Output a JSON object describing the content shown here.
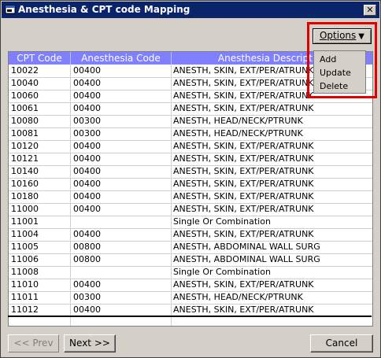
{
  "window": {
    "title": "Anesthesia & CPT code Mapping",
    "close_label": "✕"
  },
  "options_button": {
    "label": "Options",
    "arrow": "▼"
  },
  "options_menu": [
    "Add",
    "Update",
    "Delete"
  ],
  "grid": {
    "columns": [
      "CPT Code",
      "Anesthesia Code",
      "Anesthesia Description"
    ],
    "rows": [
      [
        "10022",
        "00400",
        "ANESTH, SKIN, EXT/PER/ATRUNK"
      ],
      [
        "10040",
        "00400",
        "ANESTH, SKIN, EXT/PER/ATRUNK"
      ],
      [
        "10060",
        "00400",
        "ANESTH, SKIN, EXT/PER/ATRUNK"
      ],
      [
        "10061",
        "00400",
        "ANESTH, SKIN, EXT/PER/ATRUNK"
      ],
      [
        "10080",
        "00300",
        "ANESTH, HEAD/NECK/PTRUNK"
      ],
      [
        "10081",
        "00300",
        "ANESTH, HEAD/NECK/PTRUNK"
      ],
      [
        "10120",
        "00400",
        "ANESTH, SKIN, EXT/PER/ATRUNK"
      ],
      [
        "10121",
        "00400",
        "ANESTH, SKIN, EXT/PER/ATRUNK"
      ],
      [
        "10140",
        "00400",
        "ANESTH, SKIN, EXT/PER/ATRUNK"
      ],
      [
        "10160",
        "00400",
        "ANESTH, SKIN, EXT/PER/ATRUNK"
      ],
      [
        "10180",
        "00400",
        "ANESTH, SKIN, EXT/PER/ATRUNK"
      ],
      [
        "11000",
        "00400",
        "ANESTH, SKIN, EXT/PER/ATRUNK"
      ],
      [
        "11001",
        "",
        "Single Or Combination"
      ],
      [
        "11004",
        "00400",
        "ANESTH, SKIN, EXT/PER/ATRUNK"
      ],
      [
        "11005",
        "00800",
        "ANESTH, ABDOMINAL WALL SURG"
      ],
      [
        "11006",
        "00800",
        "ANESTH, ABDOMINAL WALL SURG"
      ],
      [
        "11008",
        "",
        "Single Or Combination"
      ],
      [
        "11010",
        "00400",
        "ANESTH, SKIN, EXT/PER/ATRUNK"
      ],
      [
        "11011",
        "00300",
        "ANESTH, HEAD/NECK/PTRUNK"
      ],
      [
        "11012",
        "00400",
        "ANESTH, SKIN, EXT/PER/ATRUNK"
      ]
    ]
  },
  "footer": {
    "prev_label": "<< Prev",
    "next_label": "Next >>",
    "cancel_label": "Cancel"
  },
  "colors": {
    "title_bar": "#0a246a",
    "grid_header": "#8080ff",
    "highlight": "#e00000"
  }
}
